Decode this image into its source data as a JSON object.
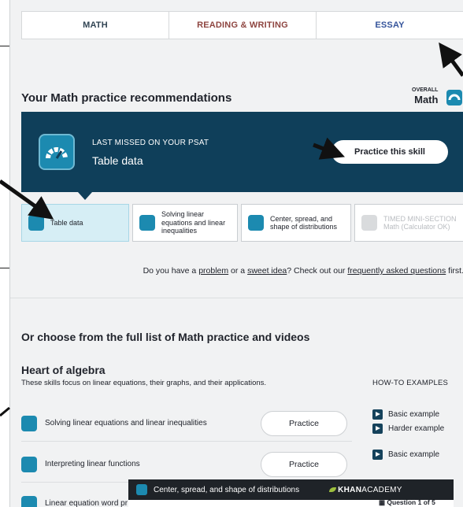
{
  "tabs": [
    {
      "label": "MATH"
    },
    {
      "label": "READING & WRITING"
    },
    {
      "label": "ESSAY"
    }
  ],
  "recommendations": {
    "title": "Your Math practice recommendations",
    "overall_label": "OVERALL",
    "overall_subject": "Math"
  },
  "banner": {
    "label": "LAST MISSED ON YOUR PSAT",
    "skill": "Table data",
    "button": "Practice this skill"
  },
  "skill_cards": [
    {
      "label": "Table data",
      "active": true
    },
    {
      "label": "Solving linear equations and linear inequalities"
    },
    {
      "label": "Center, spread, and shape of distributions"
    },
    {
      "label": "TIMED MINI-SECTION Math (Calculator OK)",
      "locked": true
    }
  ],
  "feedback": {
    "prefix": "Do you have a ",
    "problem": "problem",
    "middle": " or a ",
    "idea": "sweet idea",
    "suffix": "? Check out our ",
    "faq": "frequently asked questions",
    "end": " first."
  },
  "full_list_title": "Or choose from the full list of Math practice and videos",
  "section": {
    "title": "Heart of algebra",
    "description": "These skills focus on linear equations, their graphs, and their applications.",
    "howto_header": "HOW-TO EXAMPLES",
    "rows": [
      {
        "label": "Solving linear equations and linear inequalities",
        "button": "Practice"
      },
      {
        "label": "Interpreting linear functions",
        "button": "Practice"
      },
      {
        "label": "Linear equation word pr"
      }
    ],
    "examples": [
      "Basic example",
      "Harder example",
      "Basic example"
    ]
  },
  "video": {
    "title": "Center, spread, and shape of distributions",
    "brand_bold": "KHAN",
    "brand_rest": "ACADEMY",
    "question": "Question 1 of 5"
  },
  "colors": {
    "banner": "#0f3f5a",
    "skill_icon": "#1c8ab0",
    "active_card": "#d6eef5"
  }
}
